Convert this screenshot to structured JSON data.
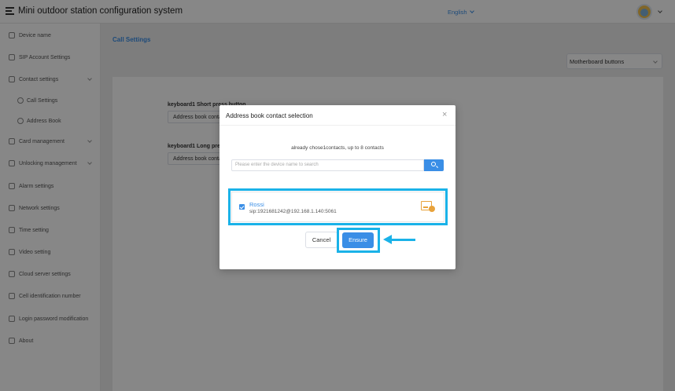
{
  "app": {
    "title": "Mini outdoor station configuration system",
    "language": "English"
  },
  "sidebar": {
    "items": [
      {
        "label": "Device name",
        "icon": "gear-icon"
      },
      {
        "label": "SIP Account Settings",
        "icon": "user-icon"
      },
      {
        "label": "Contact settings",
        "icon": "folder-icon"
      },
      {
        "label": "Call Settings",
        "icon": "phone-icon"
      },
      {
        "label": "Address Book",
        "icon": "phone-icon"
      },
      {
        "label": "Card management",
        "icon": "card-icon"
      },
      {
        "label": "Unlocking management",
        "icon": "lock-icon"
      },
      {
        "label": "Alarm settings",
        "icon": "bell-icon"
      },
      {
        "label": "Network settings",
        "icon": "network-icon"
      },
      {
        "label": "Time setting",
        "icon": "calendar-icon"
      },
      {
        "label": "Video setting",
        "icon": "video-icon"
      },
      {
        "label": "Cloud server settings",
        "icon": "cloud-icon"
      },
      {
        "label": "Cell identification number",
        "icon": "cell-icon"
      },
      {
        "label": "Login password modification",
        "icon": "eye-icon"
      },
      {
        "label": "About",
        "icon": "info-icon"
      }
    ]
  },
  "main": {
    "title": "Call Settings",
    "select_value": "Motherboard buttons",
    "field1_label": "keyboard1 Short press button",
    "field1_value": "Address book contacts",
    "field2_label": "keyboard1 Long press button",
    "field2_value": "Address book contacts"
  },
  "dialog": {
    "title": "Address book contact selection",
    "hint": "already chose1contacts, up to 8 contacts",
    "search_placeholder": "Please enter the device name to search",
    "contact": {
      "name": "Rossi",
      "sip": "sip:1921681242@192.168.1.140:5061"
    },
    "cancel_label": "Cancel",
    "ensure_label": "Ensure"
  },
  "colors": {
    "accent": "#3a8ee6",
    "highlight": "#1ab2e8",
    "device_icon": "#e8a23b"
  }
}
